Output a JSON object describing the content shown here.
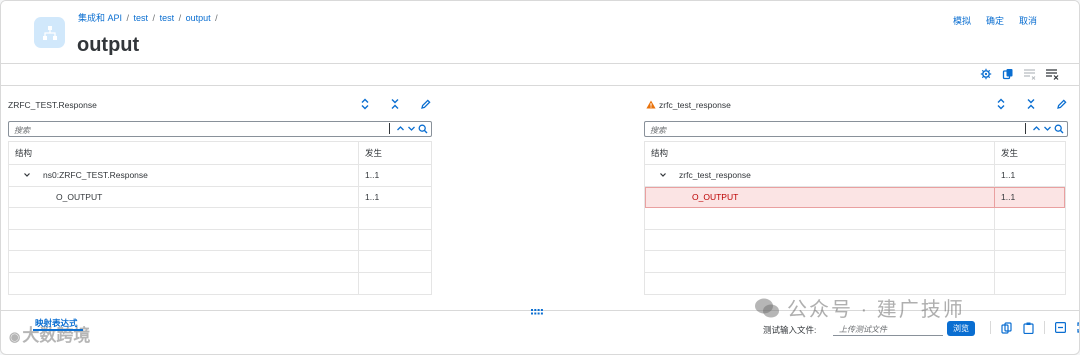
{
  "header": {
    "breadcrumbs": [
      "集成和 API",
      "test",
      "test",
      "output"
    ],
    "title": "output",
    "actions": {
      "simulate": "模拟",
      "confirm": "确定",
      "cancel": "取消"
    }
  },
  "left_panel": {
    "title": "ZRFC_TEST.Response",
    "search_placeholder": "搜索",
    "columns": {
      "structure": "结构",
      "occurrence": "发生"
    },
    "rows": [
      {
        "name": "ns0:ZRFC_TEST.Response",
        "occurrence": "1..1",
        "expanded": true
      },
      {
        "name": "O_OUTPUT",
        "occurrence": "1..1"
      }
    ]
  },
  "right_panel": {
    "title": "zrfc_test_response",
    "search_placeholder": "搜索",
    "columns": {
      "structure": "结构",
      "occurrence": "发生"
    },
    "rows": [
      {
        "name": "zrfc_test_response",
        "occurrence": "1..1",
        "expanded": true
      },
      {
        "name": "O_OUTPUT",
        "occurrence": "1..1",
        "status": "error"
      }
    ]
  },
  "footer": {
    "tab_label": "映射表达式",
    "test_file_label": "测试输入文件:",
    "file_placeholder": "上传测试文件",
    "browse_label": "浏览"
  },
  "watermarks": {
    "left": "大数跨境",
    "right": "公众号 · 建广技师"
  },
  "colors": {
    "accent": "#0a6ed1",
    "error": "#bb0000",
    "error_bg": "#fbe4e4"
  }
}
